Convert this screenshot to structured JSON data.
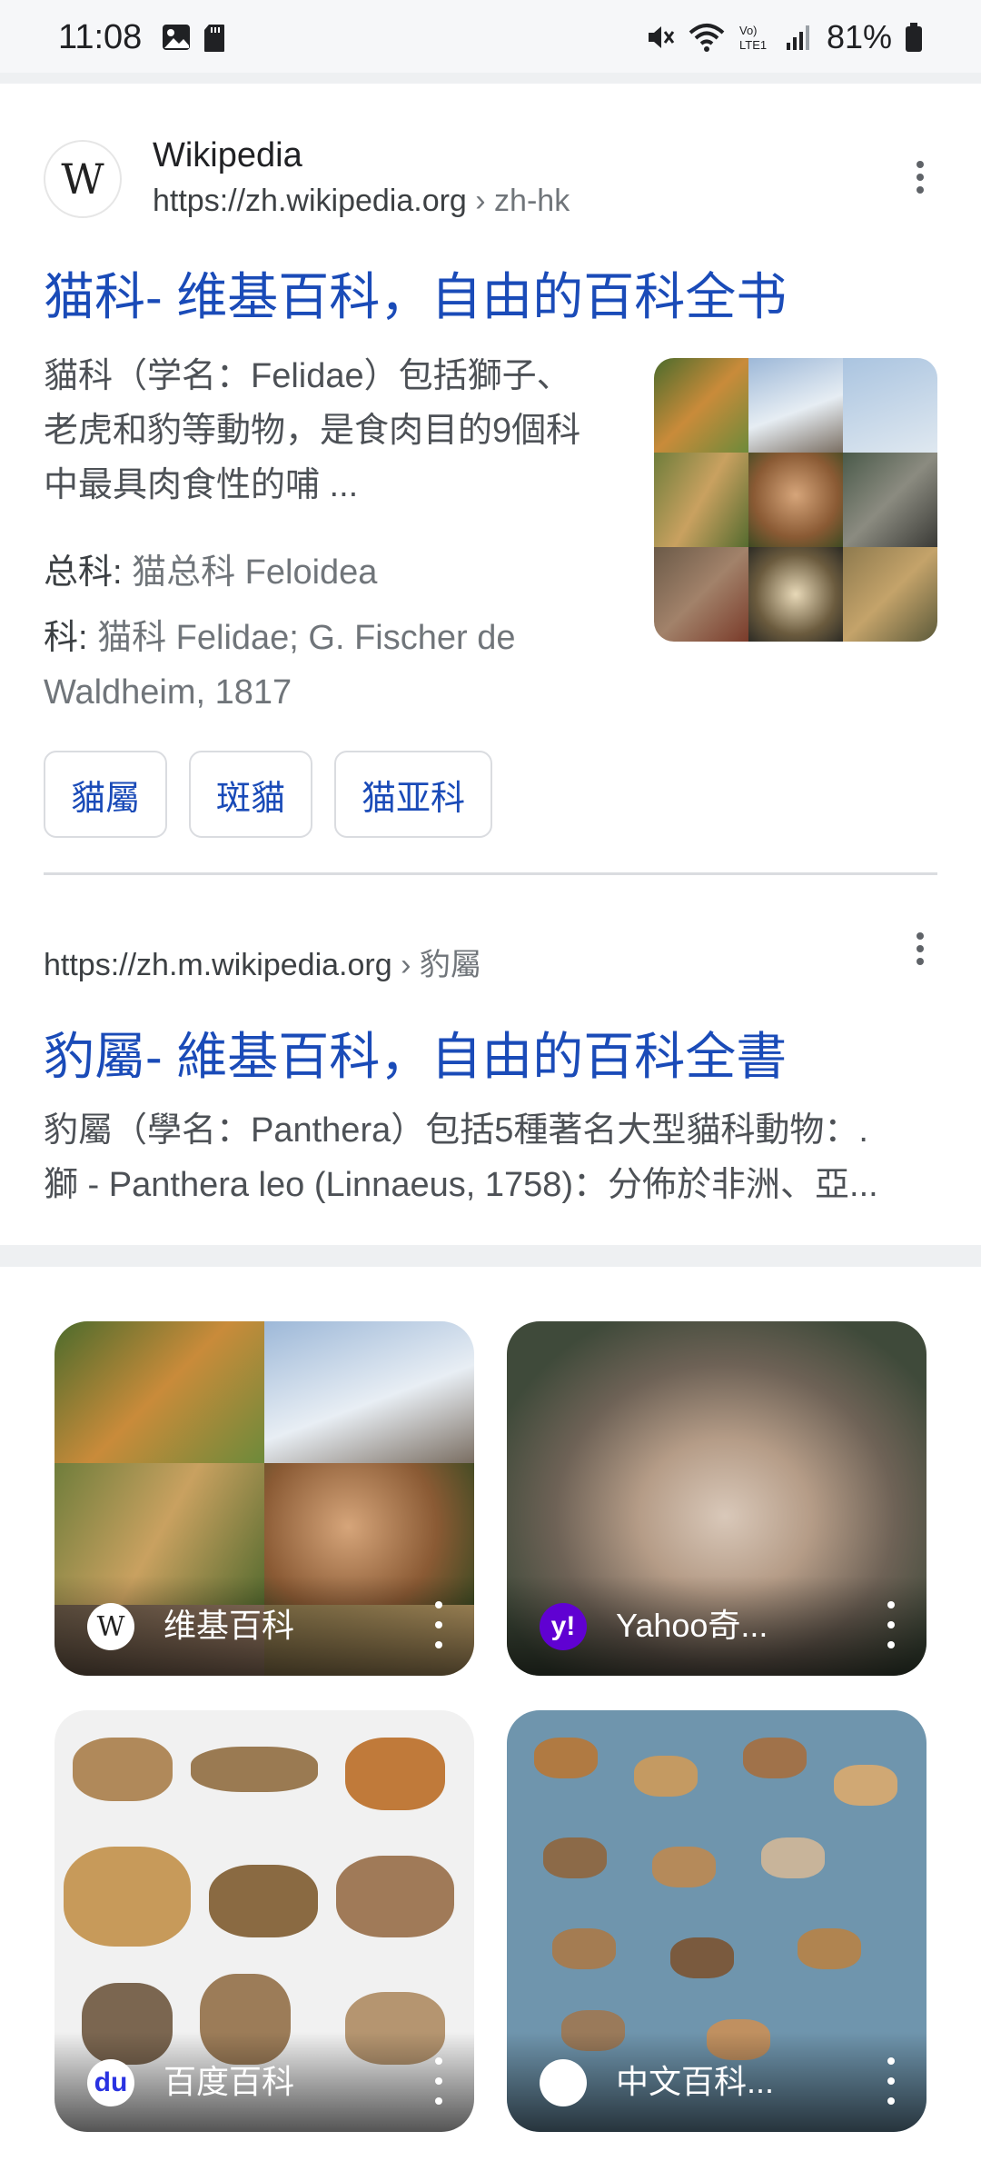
{
  "status_bar": {
    "time": "11:08",
    "battery_percent": "81%"
  },
  "results": [
    {
      "site_name": "Wikipedia",
      "url": "https://zh.wikipedia.org",
      "breadcrumb": " › zh-hk",
      "title": "猫科- 维基百科，自由的百科全书",
      "snippet_lines": [
        "貓科（学名：Felidae）包括獅子、",
        "老虎和豹等動物，是食肉目的9個科",
        "中最具肉食性的哺 ..."
      ],
      "facts": [
        {
          "key": "总科:",
          "value": " 猫总科 Feloidea"
        },
        {
          "key": "科:",
          "value": " 猫科 Felidae; G. Fischer de"
        },
        {
          "key": "",
          "value": "Waldheim, 1817"
        }
      ],
      "chips": [
        "貓屬",
        "斑貓",
        "猫亚科"
      ]
    },
    {
      "url": "https://zh.m.wikipedia.org",
      "breadcrumb": " › 豹屬",
      "title": "豹屬- 維基百科，自由的百科全書",
      "snippet_lines": [
        "豹屬（學名：Panthera）包括5種著名大型貓科動物：.",
        "獅 - Panthera leo (Linnaeus, 1758)：分佈於非洲、亞..."
      ]
    }
  ],
  "image_cards": [
    {
      "source": "维基百科",
      "logo_text": "W"
    },
    {
      "source": "Yahoo奇...",
      "logo_text": "y!"
    },
    {
      "source": "百度百科",
      "logo_text": "du"
    },
    {
      "source": "中文百科...",
      "logo_text": ""
    }
  ],
  "colors": {
    "link_blue": "#1a4bb8",
    "status_bg": "#f6f7f9",
    "yahoo_purple": "#6001d2",
    "baidu_blue": "#2932e1"
  }
}
